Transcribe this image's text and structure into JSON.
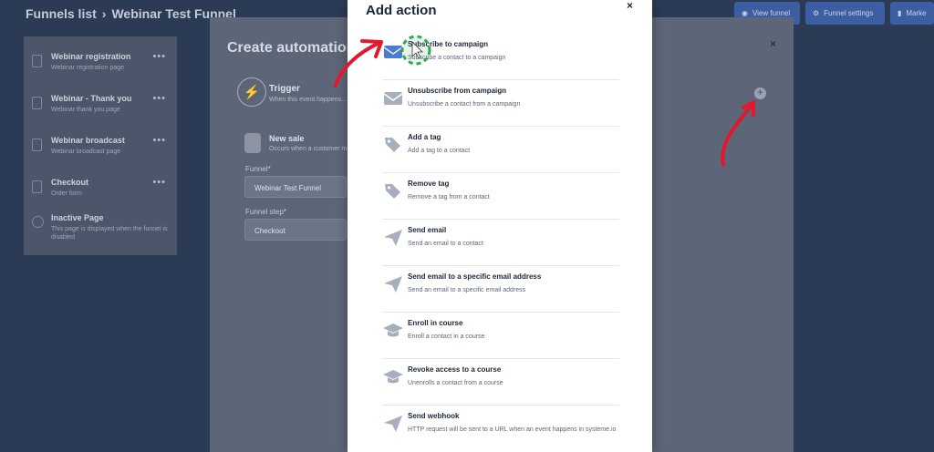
{
  "breadcrumb": {
    "parent": "Funnels list",
    "separator": "›",
    "current": "Webinar Test Funnel"
  },
  "top_buttons": [
    {
      "label": "View funnel",
      "icon": "eye-icon"
    },
    {
      "label": "Funnel settings",
      "icon": "gear-icon"
    },
    {
      "label": "Marke",
      "icon": "chart-icon"
    }
  ],
  "sidebar": {
    "steps": [
      {
        "title": "Webinar registration",
        "subtitle": "Webinar registration page"
      },
      {
        "title": "Webinar - Thank you",
        "subtitle": "Webinar thank you page"
      },
      {
        "title": "Webinar broadcast",
        "subtitle": "Webinar broadcast page"
      },
      {
        "title": "Checkout",
        "subtitle": "Order form"
      }
    ],
    "inactive": {
      "title": "Inactive Page",
      "subtitle": "This page is displayed when the funnel is disabled"
    },
    "more_label": "•••"
  },
  "rule_dialog": {
    "title": "Create automation rule",
    "close": "×",
    "trigger": {
      "title": "Trigger",
      "subtitle": "When this event happens..."
    },
    "event": {
      "title": "New sale",
      "subtitle": "Occurs when a customer m"
    },
    "funnel_label": "Funnel*",
    "funnel_value": "Webinar Test Funnel",
    "step_label": "Funnel step*",
    "step_value": "Checkout",
    "add_label": "+"
  },
  "modal": {
    "title": "Add action",
    "close": "×",
    "actions": [
      {
        "title": "Subscribe to campaign",
        "subtitle": "Subscribe a contact to a campaign",
        "icon": "envelope-icon"
      },
      {
        "title": "Unsubscribe from campaign",
        "subtitle": "Unsubscribe a contact from a campaign",
        "icon": "envelope-icon"
      },
      {
        "title": "Add a tag",
        "subtitle": "Add a tag to a contact",
        "icon": "tag-icon"
      },
      {
        "title": "Remove tag",
        "subtitle": "Remove a tag from a contact",
        "icon": "tag-icon"
      },
      {
        "title": "Send email",
        "subtitle": "Send an email to a contact",
        "icon": "paper-plane-icon"
      },
      {
        "title": "Send email to a specific email address",
        "subtitle": "Send an email to a specific email address",
        "icon": "paper-plane-icon"
      },
      {
        "title": "Enroll in course",
        "subtitle": "Enroll a contact in a course",
        "icon": "graduation-cap-icon"
      },
      {
        "title": "Revoke access to a course",
        "subtitle": "Unenrolls a contact from a course",
        "icon": "graduation-cap-icon"
      },
      {
        "title": "Send webhook",
        "subtitle": "HTTP request will be sent to a URL when an event happens in systeme.io",
        "icon": "paper-plane-icon"
      }
    ]
  },
  "colors": {
    "accent": "#3d5ea3",
    "annotation": "#e3182d",
    "highlight": "#2fa84f"
  }
}
